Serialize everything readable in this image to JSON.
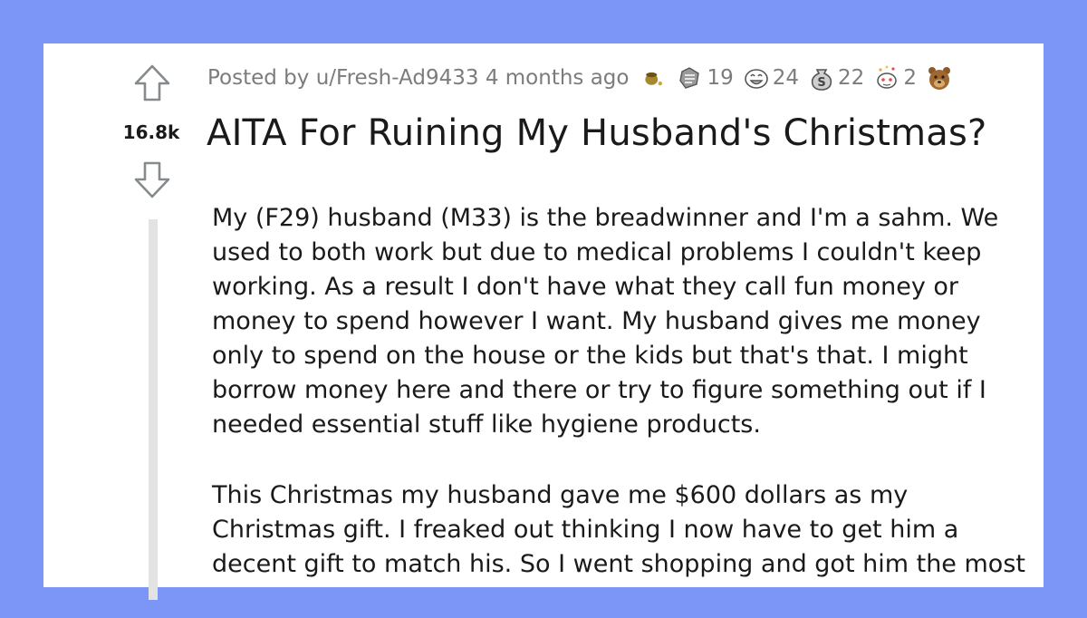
{
  "post": {
    "score": "16.8k",
    "posted_by": "Posted by u/Fresh-Ad9433 4 months ago",
    "title": "AITA For Ruining My Husband's Christmas?",
    "awards": [
      {
        "icon": "pot-award-icon",
        "count": ""
      },
      {
        "icon": "helpful-award-icon",
        "count": "19"
      },
      {
        "icon": "laughing-face-award-icon",
        "count": "24"
      },
      {
        "icon": "coin-bag-award-icon",
        "count": "22"
      },
      {
        "icon": "snoo-party-award-icon",
        "count": "2"
      },
      {
        "icon": "bear-award-icon",
        "count": ""
      }
    ],
    "paragraphs": [
      "My (F29) husband (M33) is the breadwinner and I'm a sahm. We used to both work but due to medical problems I couldn't keep working. As a result I don't have what they call fun money or money to spend however I want. My husband gives me money only to spend on the house or the kids but that's that. I might borrow money here and there or try to figure something out if I needed essential stuff like hygiene products.",
      "This Christmas my husband gave me $600 dollars as my Christmas gift. I freaked out thinking I now have to get him a decent gift to match his. So I went shopping and got him the most"
    ]
  },
  "colors": {
    "background": "#7b96f6",
    "card": "#ffffff",
    "text": "#1a1a1b",
    "meta_text": "#7c7c7c",
    "thread_line": "#e3e3e3"
  }
}
